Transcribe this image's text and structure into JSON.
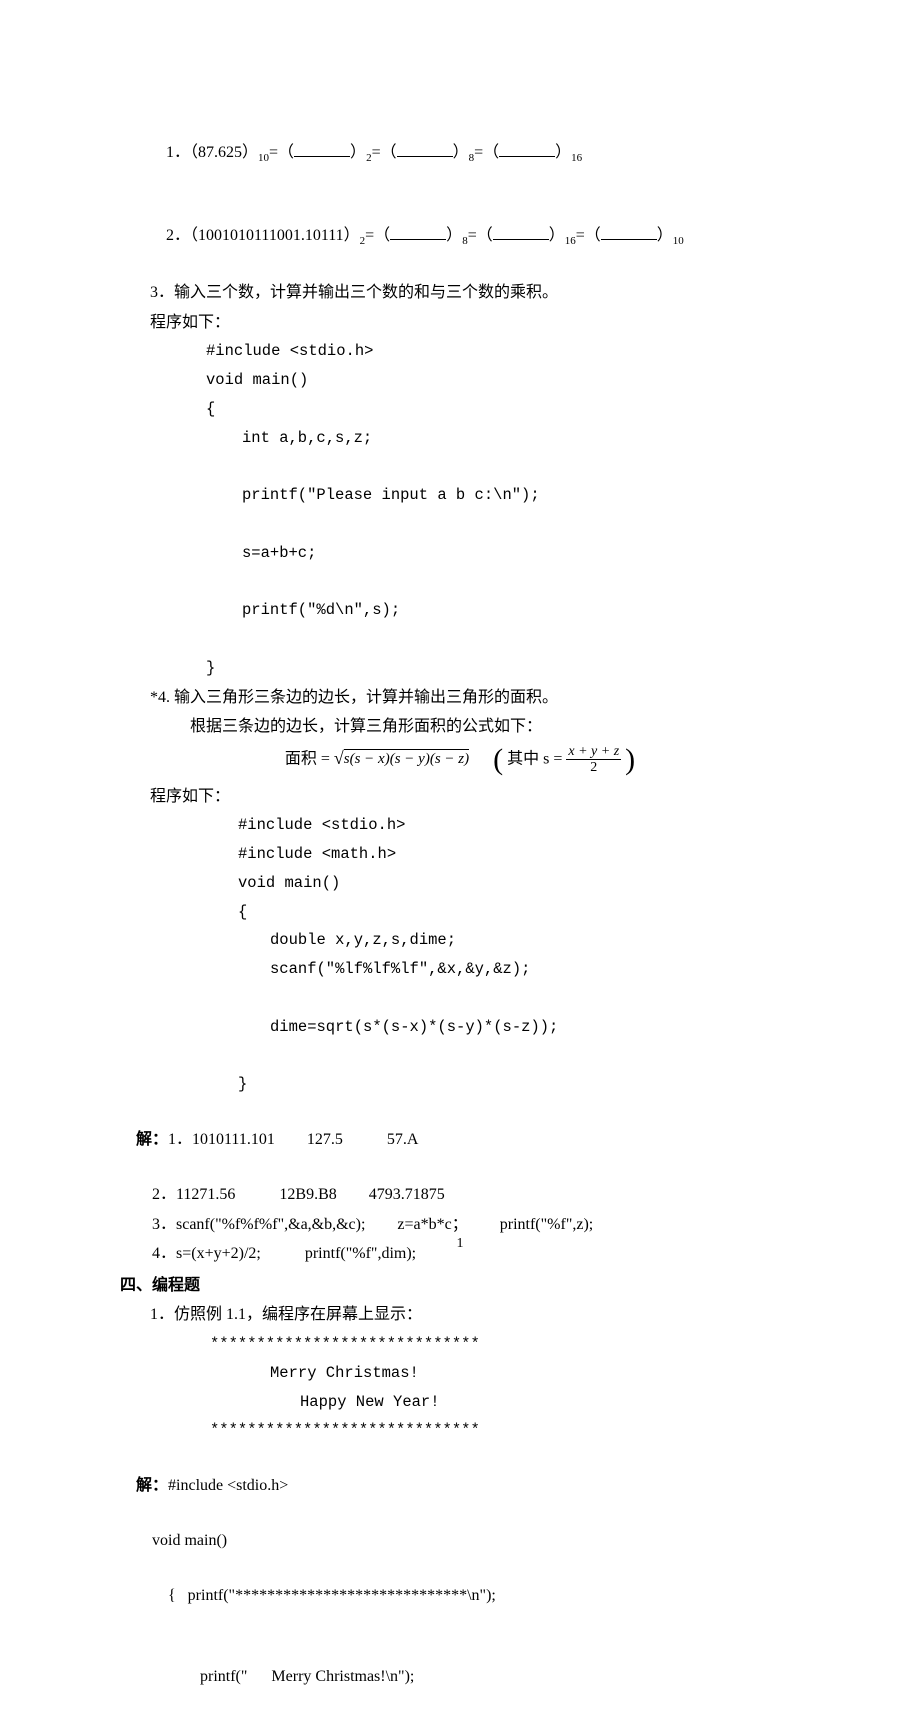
{
  "q1": {
    "prefix": "1．（87.625）",
    "s10": "10",
    "eq1": "=（",
    "close1": "）",
    "s2": "2",
    "eq2": "=（",
    "close2": "）",
    "s8": "8",
    "eq3": "=（",
    "close3": "）",
    "s16": "16"
  },
  "q2": {
    "prefix": "2．（1001010111001.10111）",
    "s2": "2",
    "eq1": "=（",
    "close1": "）",
    "s8": "8",
    "eq2": "=（",
    "close2": "）",
    "s16": "16",
    "eq3": "=（",
    "close3": "）",
    "s10": "10"
  },
  "q3": {
    "text": "3．输入三个数，计算并输出三个数的和与三个数的乘积。",
    "prog": "程序如下：",
    "c1": "#include <stdio.h>",
    "c2": "void main()",
    "c3": "{",
    "c4": "int a,b,c,s,z;",
    "c5": "printf(\"Please input a b c:\\n\");",
    "c6": "s=a+b+c;",
    "c7": "printf(\"%d\\n\",s);",
    "c8": "}"
  },
  "q4": {
    "head": "*4. 输入三角形三条边的边长，计算并输出三角形的面积。",
    "sub": "根据三条边的边长，计算三角形面积的公式如下：",
    "formula_left": "面积 =",
    "formula_rad": "s(s − x)(s − y)(s − z)",
    "formula_mid": "其中 s =",
    "frac_num": "x + y + z",
    "frac_den": "2",
    "prog": "程序如下：",
    "c1": "#include <stdio.h>",
    "c2": "#include <math.h>",
    "c3": "void main()",
    "c4": "{",
    "c5": "double x,y,z,s,dime;",
    "c6": "scanf(\"%lf%lf%lf\",&x,&y,&z);",
    "c7": "dime=sqrt(s*(s-x)*(s-y)*(s-z));",
    "c8": "}"
  },
  "ans": {
    "head": "解：",
    "a1": "1．1010111.101        127.5           57.A",
    "a2": "2．11271.56           12B9.B8        4793.71875",
    "a3": "3．scanf(\"%f%f%f\",&a,&b,&c);        z=a*b*c；        printf(\"%f\",z);",
    "a4": "4．s=(x+y+2)/2;           printf(\"%f\",dim);"
  },
  "sec4": {
    "title": "四、编程题",
    "q1": "1．仿照例 1.1，编程序在屏幕上显示：",
    "l1": "*****************************",
    "l2": "Merry Christmas!",
    "l3": "Happy New Year!",
    "l4": "*****************************"
  },
  "sol": {
    "head": "解：",
    "s1": "#include <stdio.h>",
    "s2": "void main()",
    "s3a": "{   printf(\"",
    "s3b": "*****************************\\n\");",
    "s4a": "printf(\"",
    "s4b": "      Merry Christmas!\\n\");"
  },
  "pagenum": "1"
}
